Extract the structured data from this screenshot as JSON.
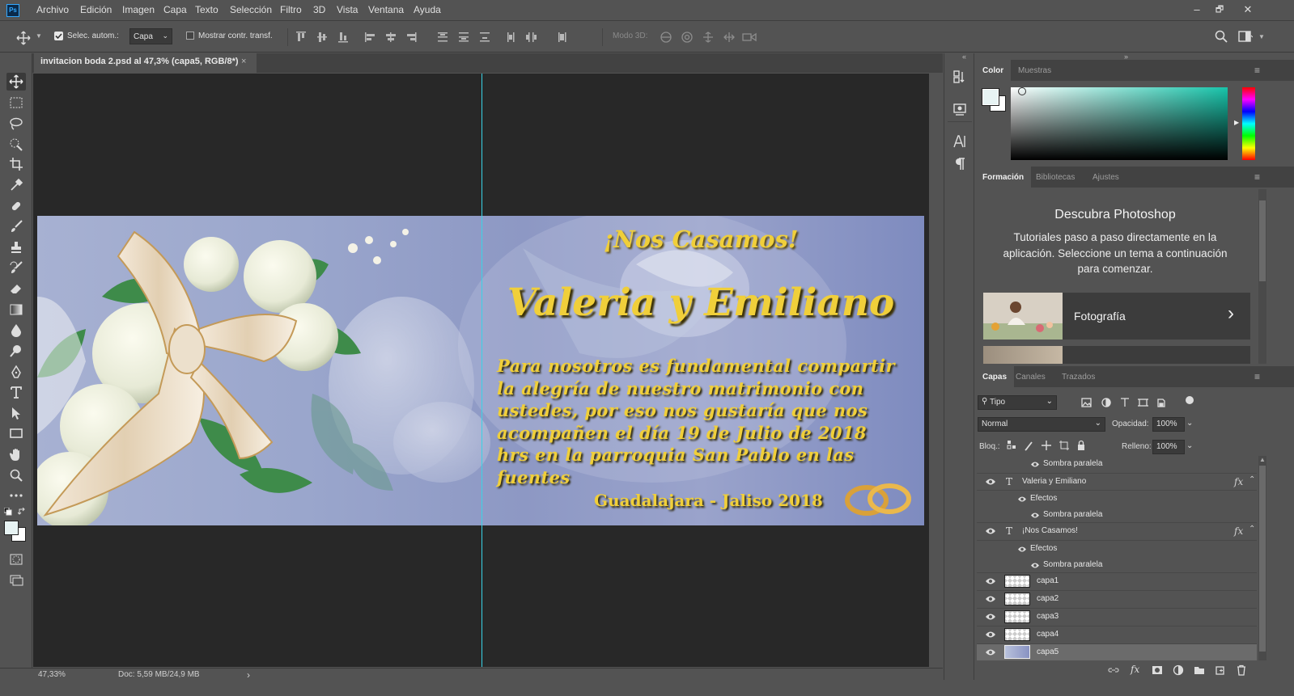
{
  "app": {
    "logo": "Ps"
  },
  "menu": [
    "Archivo",
    "Edición",
    "Imagen",
    "Capa",
    "Texto",
    "Selección",
    "Filtro",
    "3D",
    "Vista",
    "Ventana",
    "Ayuda"
  ],
  "window_controls": {
    "minimize": "–",
    "restore": "🗗",
    "close": "✕"
  },
  "options": {
    "auto_select_label": "Selec. autom.:",
    "auto_select_checked": true,
    "auto_select_target": "Capa",
    "show_transform_label": "Mostrar contr. transf.",
    "mode3d_label": "Modo 3D:"
  },
  "document": {
    "tab_title": "invitacion boda 2.psd al 47,3% (capa5, RGB/8*)",
    "close_glyph": "×"
  },
  "artwork": {
    "headline": "¡Nos Casamos!",
    "names": "Valeria y Emiliano",
    "body": "Para nosotros es fundamental compartir la alegría de nuestro matrimonio con ustedes, por eso nos gustaría que nos acompañen el día 19 de Julio de 2018 hrs en la parroquia San Pablo en las fuentes",
    "footer": "Guadalajara - Jaliso 2018",
    "text_color": "#f0cf3a"
  },
  "status": {
    "zoom": "47,33%",
    "doc": "Doc: 5,59 MB/24,9 MB",
    "arrow": "›"
  },
  "panels": {
    "color": {
      "tabs": [
        "Color",
        "Muestras"
      ],
      "active": 0,
      "fg_color": "#e8f4f4",
      "bg_color": "#ffffff",
      "picker_hue": "#18c4aa"
    },
    "learn": {
      "tabs": [
        "Formación",
        "Bibliotecas",
        "Ajustes"
      ],
      "active": 0,
      "title": "Descubra Photoshop",
      "description": "Tutoriales paso a paso directamente en la aplicación. Seleccione un tema a continuación para comenzar.",
      "card_label": "Fotografía",
      "card_arrow": "›"
    },
    "layers": {
      "tabs": [
        "Capas",
        "Canales",
        "Trazados"
      ],
      "active": 0,
      "filter": "Tipo",
      "blend": "Normal",
      "opacity_label": "Opacidad:",
      "opacity": "100%",
      "lock_label": "Bloq.:",
      "fill_label": "Relleno:",
      "fill": "100%",
      "rows": [
        {
          "kind": "effect",
          "label": "Sombra paralela"
        },
        {
          "kind": "text",
          "label": "Valeria y Emiliano",
          "fx": "fx"
        },
        {
          "kind": "group",
          "label": "Efectos"
        },
        {
          "kind": "effect",
          "label": "Sombra paralela"
        },
        {
          "kind": "text",
          "label": "¡Nos Casamos!",
          "fx": "fx"
        },
        {
          "kind": "group",
          "label": "Efectos"
        },
        {
          "kind": "effect",
          "label": "Sombra paralela"
        },
        {
          "kind": "pixel",
          "label": "capa1"
        },
        {
          "kind": "pixel",
          "label": "capa2"
        },
        {
          "kind": "pixel",
          "label": "capa3"
        },
        {
          "kind": "pixel",
          "label": "capa4"
        },
        {
          "kind": "pixel",
          "label": "capa5",
          "selected": true
        }
      ]
    }
  }
}
